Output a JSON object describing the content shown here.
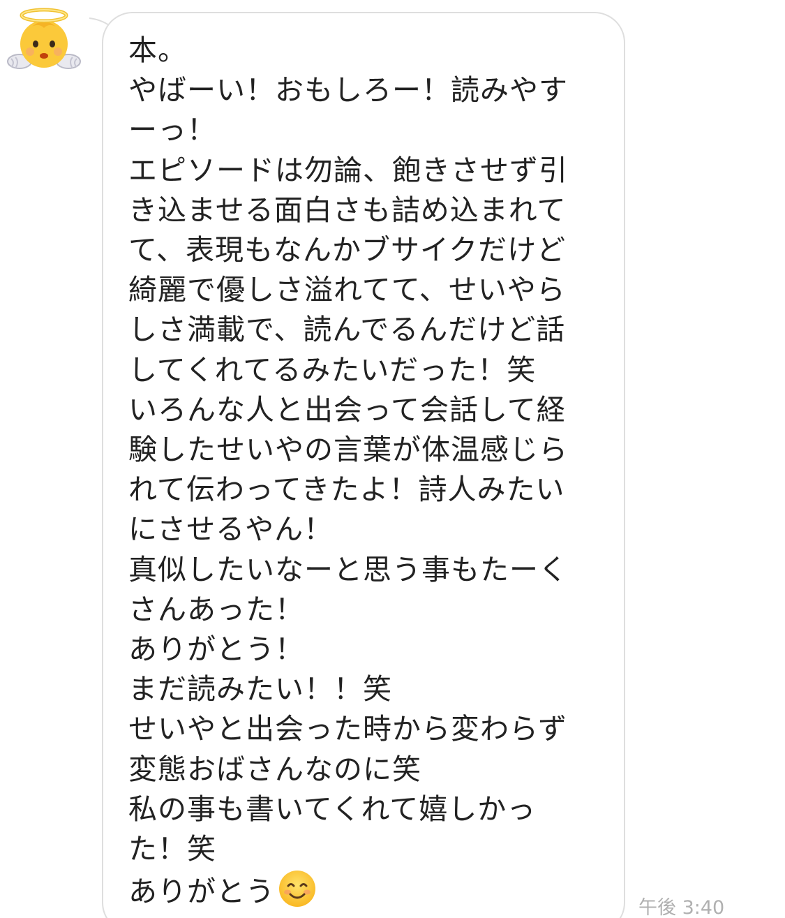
{
  "message": {
    "sender_avatar_icon": "angel-baby-emoji-icon",
    "lines": [
      "本。",
      "やばーい！おもしろー！読みやす",
      "ーっ！",
      "エピソードは勿論、飽きさせず引",
      "き込ませる面白さも詰め込まれて",
      "て、表現もなんかブサイクだけど",
      "綺麗で優しさ溢れてて、せいやら",
      "しさ満載で、読んでるんだけど話",
      "してくれてるみたいだった！笑",
      "いろんな人と出会って会話して経",
      "験したせいやの言葉が体温感じら",
      "れて伝わってきたよ！詩人みたい",
      "にさせるやん！",
      "真似したいなーと思う事もたーく",
      "さんあった！",
      "ありがとう！",
      "まだ読みたい！！笑",
      "せいやと出会った時から変わらず",
      "変態おばさんなのに笑",
      "私の事も書いてくれて嬉しかっ",
      "た！笑",
      "ありがとう"
    ],
    "end_emoji_icon": "smiling-face-emoji-icon",
    "timestamp": "午後 3:40"
  },
  "colors": {
    "bubble_border": "#dedede",
    "text": "#222222",
    "timestamp": "#b0b0b0"
  }
}
